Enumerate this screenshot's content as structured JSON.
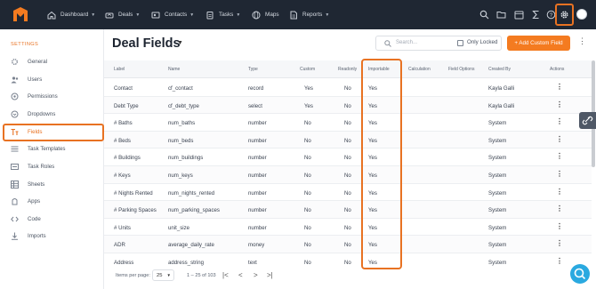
{
  "nav": {
    "items": [
      {
        "label": "Dashboard",
        "icon": "home-icon",
        "has_menu": true
      },
      {
        "label": "Deals",
        "icon": "handshake-icon",
        "has_menu": true
      },
      {
        "label": "Contacts",
        "icon": "contacts-icon",
        "has_menu": true
      },
      {
        "label": "Tasks",
        "icon": "clipboard-icon",
        "has_menu": true
      },
      {
        "label": "Maps",
        "icon": "globe-icon",
        "has_menu": false
      },
      {
        "label": "Reports",
        "icon": "report-icon",
        "has_menu": true
      }
    ],
    "right_icons": [
      "search-icon",
      "folder-icon",
      "calendar-icon",
      "sigma-icon",
      "help-icon",
      "gear-icon",
      "avatar"
    ]
  },
  "sidebar": {
    "title": "SETTINGS",
    "items": [
      {
        "label": "General",
        "icon": "gear-icon"
      },
      {
        "label": "Users",
        "icon": "users-icon"
      },
      {
        "label": "Permissions",
        "icon": "key-icon"
      },
      {
        "label": "Dropdowns",
        "icon": "dropdown-icon"
      },
      {
        "label": "Fields",
        "icon": "text-field-icon",
        "active": true
      },
      {
        "label": "Task Templates",
        "icon": "list-icon"
      },
      {
        "label": "Task Roles",
        "icon": "roles-icon"
      },
      {
        "label": "Sheets",
        "icon": "sheet-icon"
      },
      {
        "label": "Apps",
        "icon": "apps-icon"
      },
      {
        "label": "Code",
        "icon": "code-icon"
      },
      {
        "label": "Imports",
        "icon": "import-icon"
      }
    ]
  },
  "header": {
    "title": "Deal Fields",
    "search_placeholder": "Search...",
    "only_locked_label": "Only Locked",
    "add_button_label": "+ Add Custom Field"
  },
  "table": {
    "columns": [
      "Label",
      "Name",
      "Type",
      "Custom",
      "Readonly",
      "Importable",
      "Calculation",
      "Field Options",
      "Created By",
      "Actions"
    ],
    "rows": [
      [
        "Contact",
        "cf_contact",
        "record",
        "Yes",
        "No",
        "Yes",
        "",
        "",
        "Kayla Galli"
      ],
      [
        "Debt Type",
        "cf_debt_type",
        "select",
        "Yes",
        "No",
        "Yes",
        "",
        "",
        "Kayla Galli"
      ],
      [
        "# Baths",
        "num_baths",
        "number",
        "No",
        "No",
        "Yes",
        "",
        "",
        "System"
      ],
      [
        "# Beds",
        "num_beds",
        "number",
        "No",
        "No",
        "Yes",
        "",
        "",
        "System"
      ],
      [
        "# Buildings",
        "num_buildings",
        "number",
        "No",
        "No",
        "Yes",
        "",
        "",
        "System"
      ],
      [
        "# Keys",
        "num_keys",
        "number",
        "No",
        "No",
        "Yes",
        "",
        "",
        "System"
      ],
      [
        "# Nights Rented",
        "num_nights_rented",
        "number",
        "No",
        "No",
        "Yes",
        "",
        "",
        "System"
      ],
      [
        "# Parking Spaces",
        "num_parking_spaces",
        "number",
        "No",
        "No",
        "Yes",
        "",
        "",
        "System"
      ],
      [
        "# Units",
        "unit_size",
        "number",
        "No",
        "No",
        "Yes",
        "",
        "",
        "System"
      ],
      [
        "ADR",
        "average_daily_rate",
        "money",
        "No",
        "No",
        "Yes",
        "",
        "",
        "System"
      ],
      [
        "Address",
        "address_string",
        "text",
        "No",
        "No",
        "Yes",
        "",
        "",
        "System"
      ]
    ]
  },
  "footer": {
    "items_per_page_label": "Items per page:",
    "per_page_value": "25",
    "range_text": "1 – 25 of 103",
    "first": "|<",
    "prev": "<",
    "next": ">",
    "last": ">|"
  },
  "colors": {
    "accent": "#e87222",
    "nav_bg": "#1f2733",
    "add_button": "#f47b20",
    "help_bubble": "#2aa9e0"
  }
}
